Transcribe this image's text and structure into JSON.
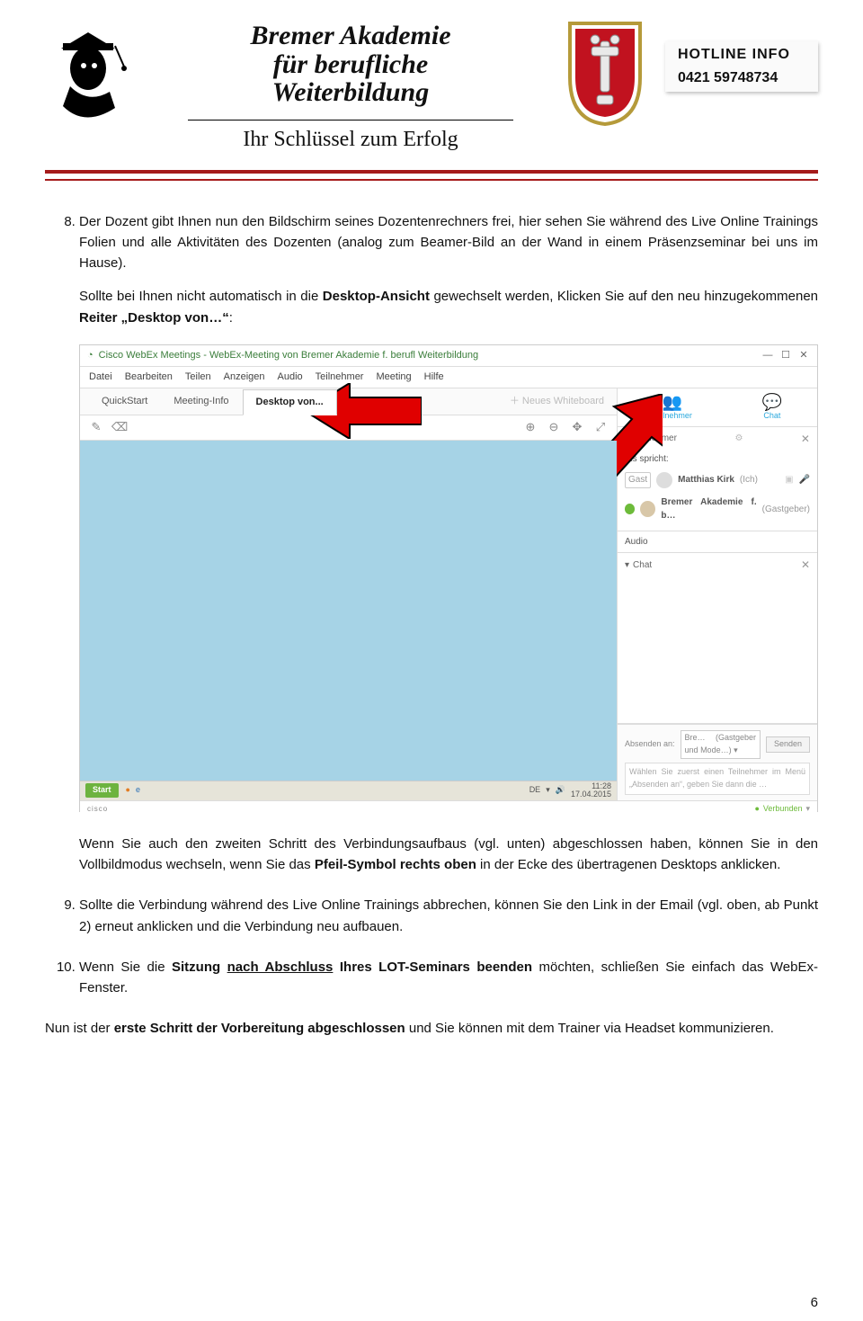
{
  "letterhead": {
    "title_l1": "Bremer Akademie",
    "title_l2": "für berufliche",
    "title_l3": "Weiterbildung",
    "subtitle": "Ihr Schlüssel zum Erfolg"
  },
  "hotline": {
    "label": "HOTLINE INFO",
    "number": "0421 59748734"
  },
  "list_start": 8,
  "item8": {
    "text": "Der Dozent gibt Ihnen nun den Bildschirm seines Dozentenrechners frei, hier sehen Sie während des Live Online Trainings Folien und alle Aktivitäten des Dozenten (analog zum Beamer-Bild an der Wand in einem Präsenzseminar bei uns im Hause).",
    "note_pre": "Sollte bei Ihnen nicht automatisch in die ",
    "note_b1": "Desktop-Ansicht",
    "note_mid": " gewechselt werden, Klicken Sie auf den neu hinzugekommenen ",
    "note_b2": "Reiter „Desktop von…“",
    "note_post": ":"
  },
  "after_ss": {
    "pre": "Wenn Sie auch den zweiten Schritt des Verbindungsaufbaus (vgl. unten) abgeschlossen haben, können Sie in den Vollbildmodus wechseln, wenn Sie das ",
    "bold": "Pfeil-Symbol rechts oben",
    "post": " in der Ecke des übertragenen Desktops anklicken."
  },
  "item9": "Sollte die Verbindung während des Live Online Trainings abbrechen, können Sie den Link in der Email (vgl. oben, ab Punkt 2) erneut anklicken und die Verbindung neu aufbauen.",
  "item10": {
    "pre": "Wenn Sie die ",
    "bold_pre": "Sitzung ",
    "bold_u": "nach Abschluss",
    "bold_post": " Ihres LOT-Seminars beenden",
    "post": " möchten, schließen Sie einfach das WebEx-Fenster."
  },
  "closing": {
    "pre": "Nun ist der ",
    "bold": "erste Schritt der Vorbereitung abgeschlossen",
    "post": " und Sie können mit dem Trainer via Headset kommunizieren."
  },
  "page_number": "6",
  "webex": {
    "title": "Cisco WebEx Meetings - WebEx-Meeting von Bremer Akademie f. berufl Weiterbildung",
    "menus": [
      "Datei",
      "Bearbeiten",
      "Teilen",
      "Anzeigen",
      "Audio",
      "Teilnehmer",
      "Meeting",
      "Hilfe"
    ],
    "tabs": {
      "quickstart": "QuickStart",
      "meeting_info": "Meeting-Info",
      "desktop_von": "Desktop von..."
    },
    "new_whiteboard": "Neues Whiteboard",
    "right_icons": {
      "participants": "Teilnehmer",
      "chat": "Chat"
    },
    "panel_participants": "Teilnehmer",
    "speaking": "Es spricht:",
    "participant1": {
      "name": "Matthias Kirk",
      "suffix": "(Ich)"
    },
    "participant2": {
      "name": "Bremer Akademie f. b…",
      "suffix": "(Gastgeber)"
    },
    "panel_audio": "Audio",
    "panel_chat": "Chat",
    "send_to_label": "Absenden an:",
    "send_to_value": "Bre…  (Gastgeber und Mode…) ▾",
    "compose_placeholder": "Wählen Sie zuerst einen Teilnehmer im Menü „Absenden an“, geben Sie dann die …",
    "send_btn": "Senden",
    "cisco": "cisco",
    "connected": "Verbunden",
    "taskbar": {
      "start": "Start",
      "lang": "DE",
      "time": "11:28",
      "date": "17.04.2015"
    }
  }
}
